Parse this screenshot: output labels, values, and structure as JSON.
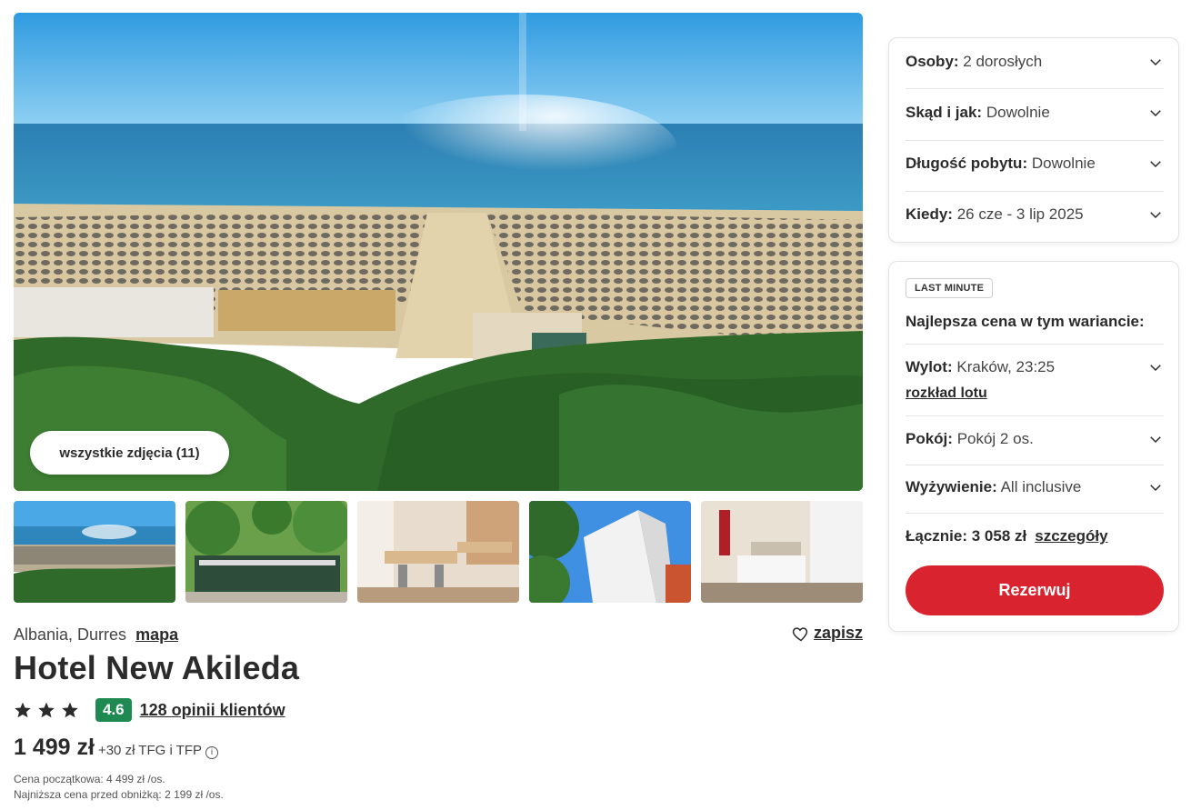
{
  "gallery": {
    "all_photos_label": "wszystkie zdjęcia (11)",
    "thumbnails": [
      "beach-photo",
      "hotel-entrance-photo",
      "restaurant-photo",
      "hotel-building-photo",
      "hotel-room-photo"
    ]
  },
  "hotel": {
    "location": "Albania, Durres",
    "map_label": "mapa",
    "save_label": "zapisz",
    "name": "Hotel New Akileda",
    "stars": 3,
    "score": "4.6",
    "reviews_label": "128 opinii klientów",
    "price": "1 499 zł",
    "price_extra": "+30 zł TFG i TFP",
    "starting_price_note": "Cena początkowa: 4 499 zł /os.",
    "lowest_price_note": "Najniższa cena przed obniżką: 2 199 zł /os."
  },
  "search": {
    "persons_key": "Osoby:",
    "persons_value": "2 dorosłych",
    "from_key": "Skąd i jak:",
    "from_value": "Dowolnie",
    "length_key": "Długość pobytu:",
    "length_value": "Dowolnie",
    "when_key": "Kiedy:",
    "when_value": "26 cze - 3 lip 2025"
  },
  "offer": {
    "badge": "LAST MINUTE",
    "best_price": "Najlepsza cena w tym wariancie:",
    "flight_key": "Wylot:",
    "flight_value": "Kraków, 23:25",
    "flight_schedule": "rozkład lotu",
    "room_key": "Pokój:",
    "room_value": "Pokój 2 os.",
    "board_key": "Wyżywienie:",
    "board_value": "All inclusive",
    "total": "Łącznie: 3 058 zł",
    "details": "szczegóły",
    "book_label": "Rezerwuj"
  },
  "colors": {
    "accent_red": "#d9232e",
    "rating_green": "#1e8a52",
    "text_dark": "#2b2b2b"
  }
}
